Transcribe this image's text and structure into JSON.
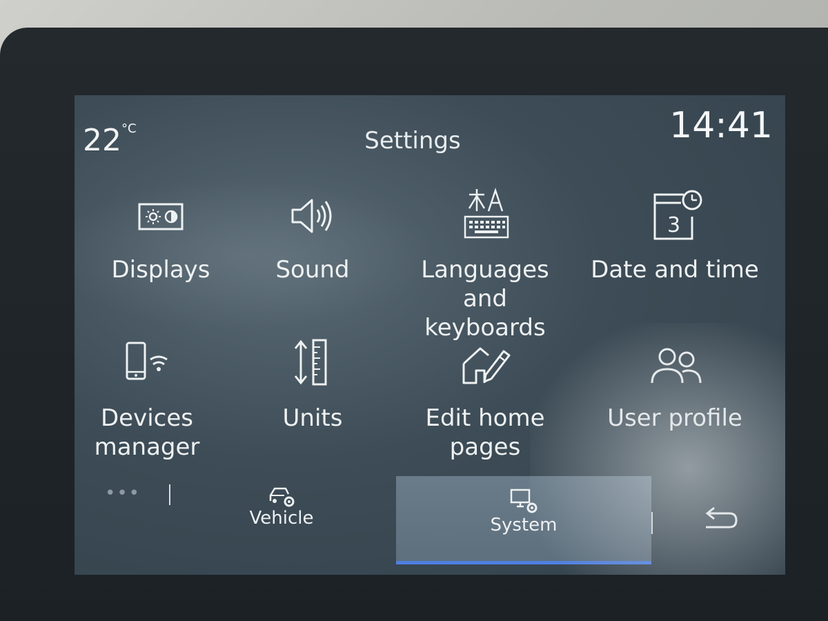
{
  "status": {
    "temperature": "22",
    "temperature_unit": "°C",
    "title": "Settings",
    "clock": "14:41"
  },
  "tiles": [
    {
      "label": "Displays",
      "icon": "display-brightness-icon"
    },
    {
      "label": "Sound",
      "icon": "speaker-icon"
    },
    {
      "label": "Languages and keyboards",
      "icon": "language-keyboard-icon"
    },
    {
      "label": "Date and time",
      "icon": "calendar-clock-icon"
    },
    {
      "label": "Devices manager",
      "icon": "phone-wifi-icon"
    },
    {
      "label": "Units",
      "icon": "ruler-arrows-icon"
    },
    {
      "label": "Edit home pages",
      "icon": "home-edit-icon"
    },
    {
      "label": "User profile",
      "icon": "users-icon"
    }
  ],
  "tabs": [
    {
      "label": "Vehicle",
      "icon": "car-gear-icon",
      "active": false
    },
    {
      "label": "System",
      "icon": "monitor-gear-icon",
      "active": true
    }
  ],
  "back_icon": "back-arrow-icon",
  "more_indicator": "•••",
  "colors": {
    "text": "#eef1f2",
    "active_tab": "#5d6f7d",
    "active_underline": "#4f7fe0"
  }
}
